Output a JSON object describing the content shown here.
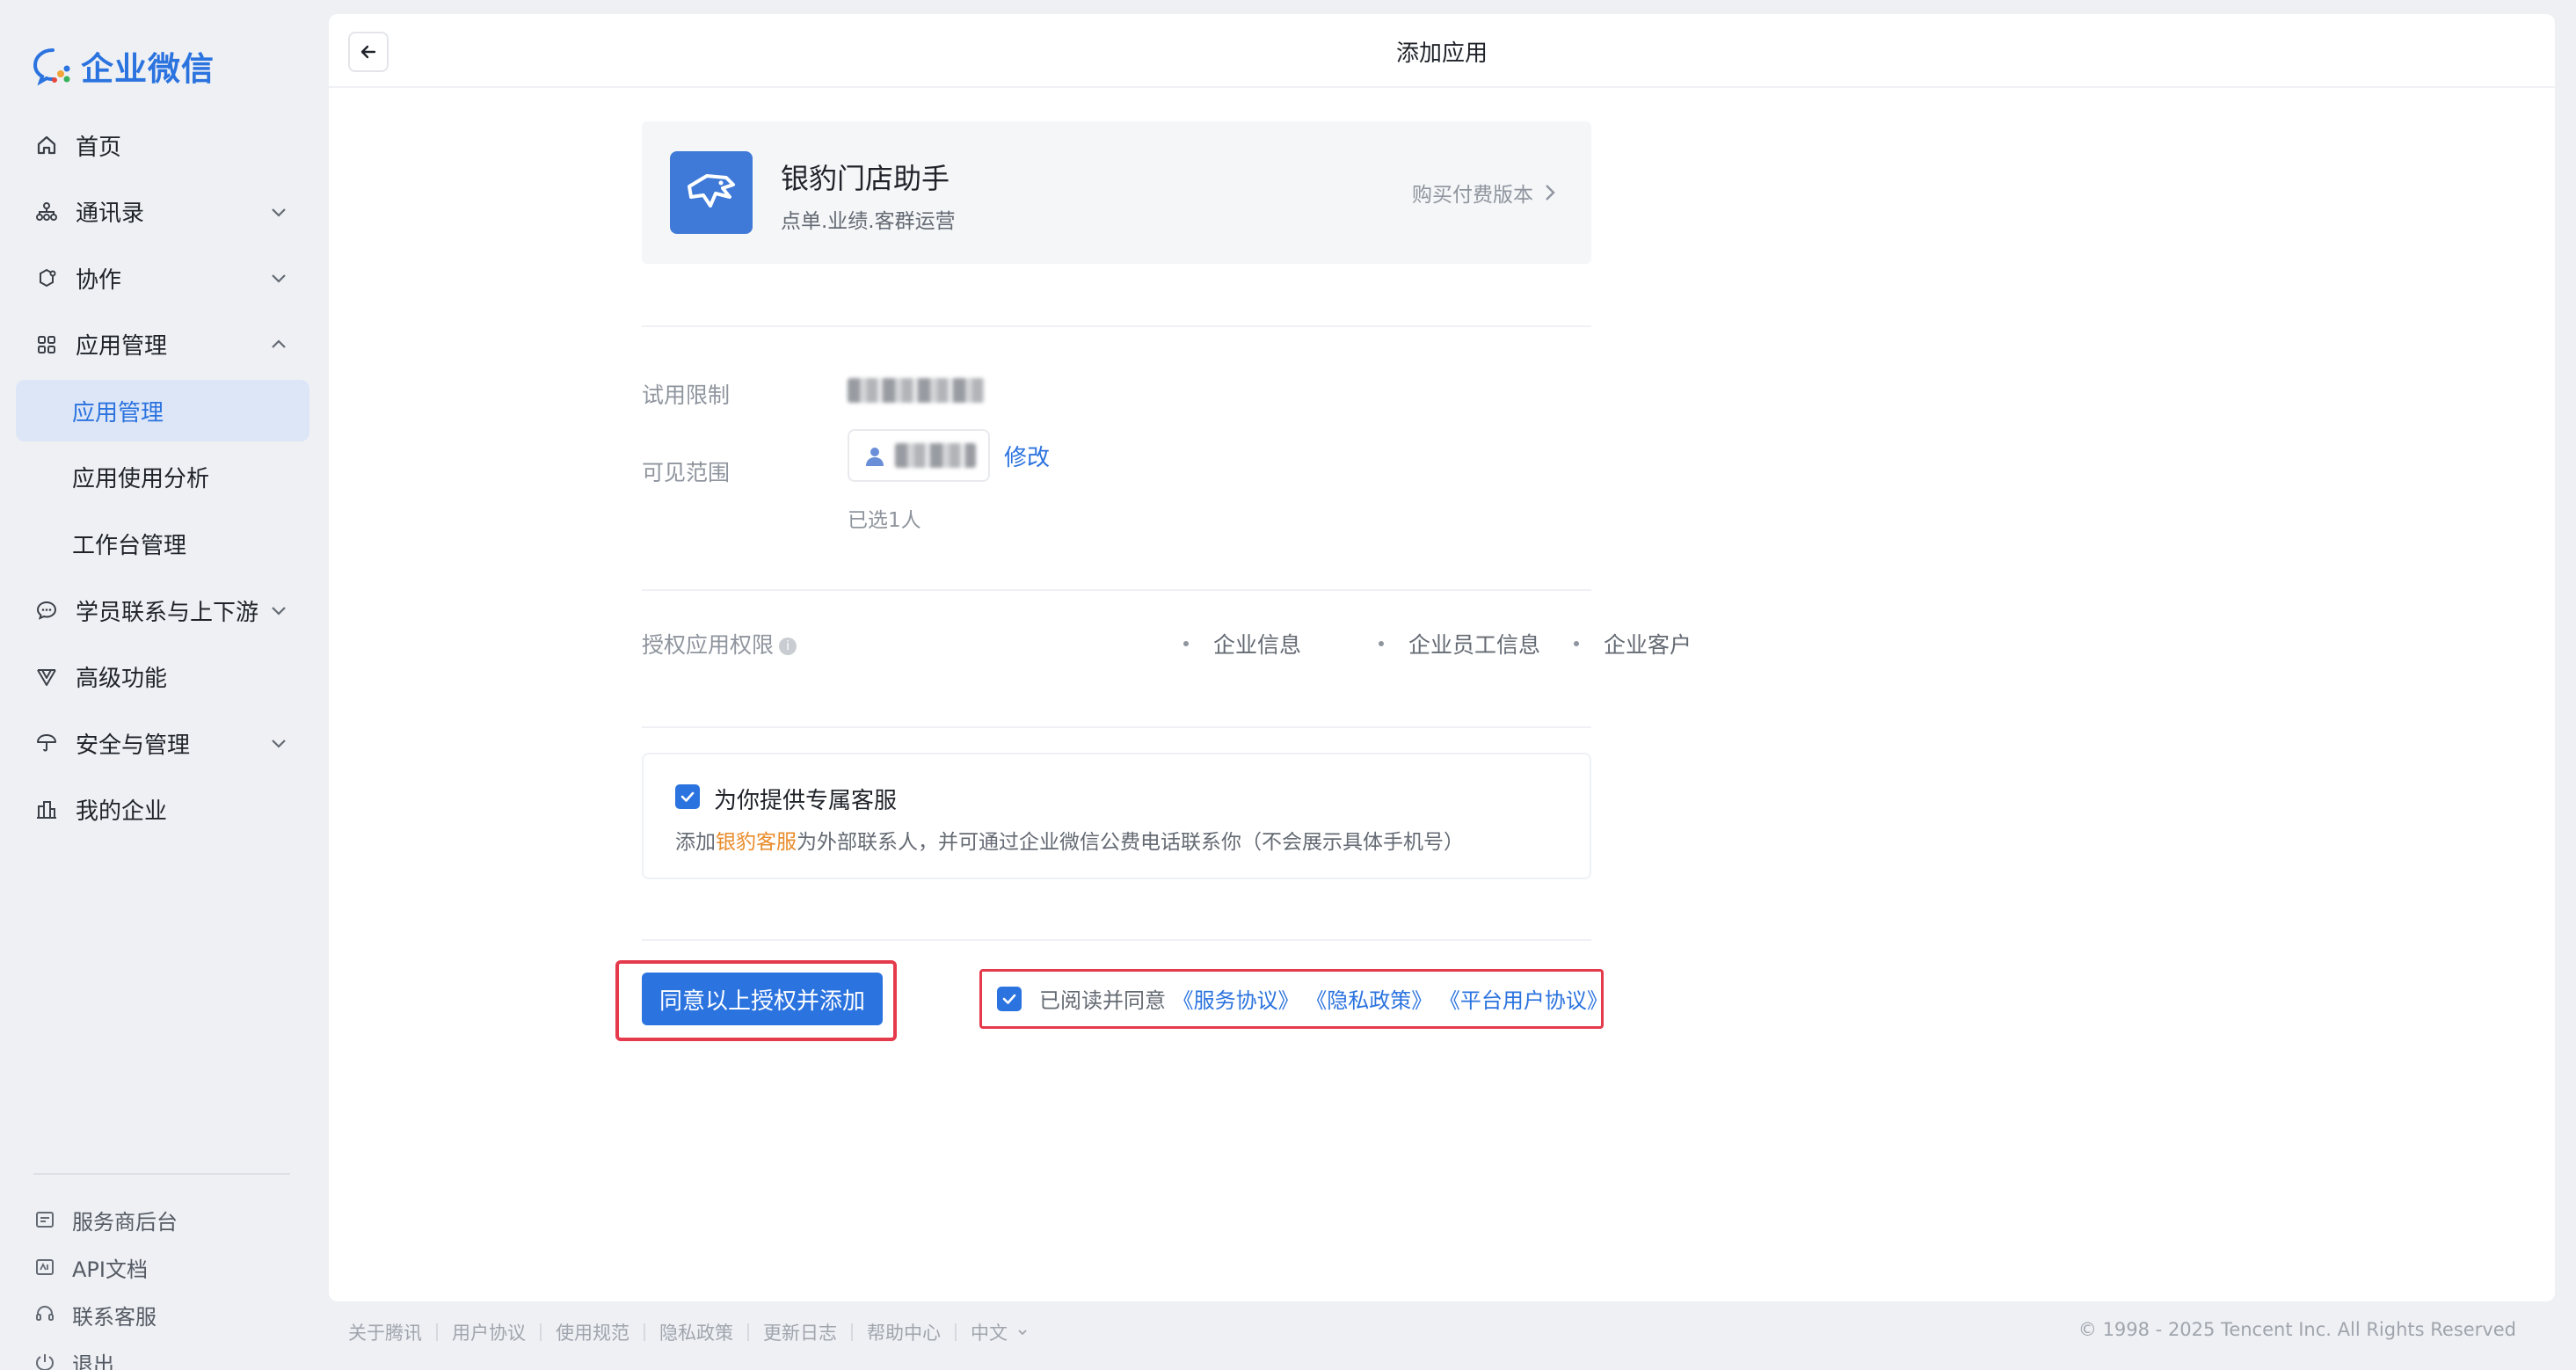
{
  "brand": {
    "name": "企业微信",
    "accent": "#2b73df"
  },
  "sidebar": {
    "items": [
      {
        "label": "首页",
        "icon": "home-icon"
      },
      {
        "label": "通讯录",
        "icon": "org-icon"
      },
      {
        "label": "协作",
        "icon": "collab-icon"
      },
      {
        "label": "应用管理",
        "icon": "apps-icon"
      },
      {
        "label": "应用管理"
      },
      {
        "label": "应用使用分析"
      },
      {
        "label": "工作台管理"
      },
      {
        "label": "学员联系与上下游",
        "icon": "chat-icon"
      },
      {
        "label": "高级功能",
        "icon": "advanced-icon"
      },
      {
        "label": "安全与管理",
        "icon": "umbrella-icon"
      },
      {
        "label": "我的企业",
        "icon": "building-icon"
      }
    ],
    "bottom": [
      {
        "label": "服务商后台",
        "icon": "provider-icon"
      },
      {
        "label": "API文档",
        "icon": "api-icon"
      },
      {
        "label": "联系客服",
        "icon": "support-icon"
      },
      {
        "label": "退出",
        "icon": "logout-icon"
      }
    ]
  },
  "header": {
    "title": "添加应用"
  },
  "app": {
    "name": "银豹门店助手",
    "desc": "点单.业绩.客群运营",
    "buy_label": "购买付费版本"
  },
  "trial": {
    "label": "试用限制"
  },
  "scope": {
    "label": "可见范围",
    "modify_label": "修改",
    "selected_note": "已选1人"
  },
  "permissions": {
    "label": "授权应用权限",
    "items": [
      "企业信息",
      "企业员工信息",
      "企业客户"
    ]
  },
  "service": {
    "title": "为你提供专属客服",
    "desc_prefix": "添加",
    "desc_highlight": "银豹客服",
    "desc_suffix": "为外部联系人，并可通过企业微信公费电话联系你（不会展示具体手机号）"
  },
  "actions": {
    "agree_button": "同意以上授权并添加"
  },
  "terms": {
    "prefix": "已阅读并同意",
    "service_agreement": "《服务协议》",
    "privacy_policy": "《隐私政策》",
    "platform_agreement": "《平台用户协议》"
  },
  "footer": {
    "links": [
      "关于腾讯",
      "用户协议",
      "使用规范",
      "隐私政策",
      "更新日志",
      "帮助中心",
      "中文"
    ],
    "copyright": "© 1998 - 2025 Tencent Inc. All Rights Reserved"
  }
}
